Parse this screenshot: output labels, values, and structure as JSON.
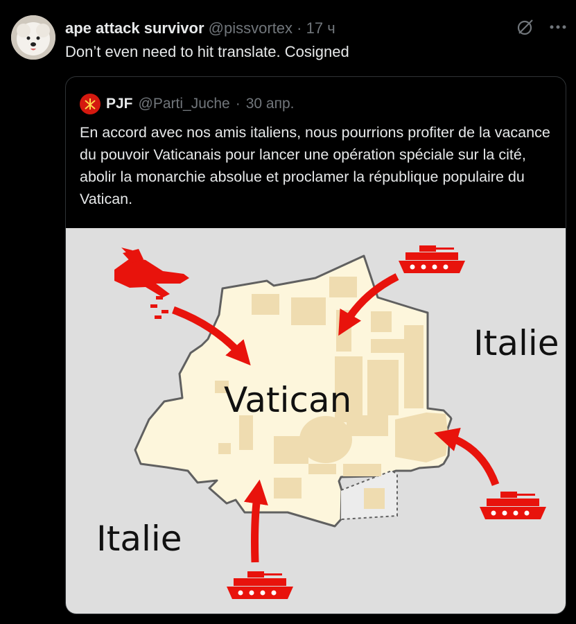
{
  "post": {
    "author_name": "ape attack survivor",
    "author_handle": "@pissvortex",
    "separator": "·",
    "time": "17 ч",
    "text": "Don’t even need to hit translate. Cosigned",
    "icons": [
      "grok-icon",
      "more-icon"
    ]
  },
  "quoted": {
    "author_name": "PJF",
    "author_handle": "@Parti_Juche",
    "separator": "·",
    "date": "30 апр.",
    "text": "En accord avec nos amis italiens, nous pourrions profiter de la vacance du pouvoir Vaticanais pour lancer une opération spéciale sur la cité, abolir la monarchie absolue et proclamer la république populaire du Vatican."
  },
  "map": {
    "label_center": "Vatican",
    "label_right": "Italie",
    "label_bottom": "Italie",
    "colors": {
      "arrow": "#e8130c",
      "city": "#fdf6dc",
      "buildings": "#efdcb0",
      "border": "#606060",
      "background": "#dedede"
    }
  }
}
